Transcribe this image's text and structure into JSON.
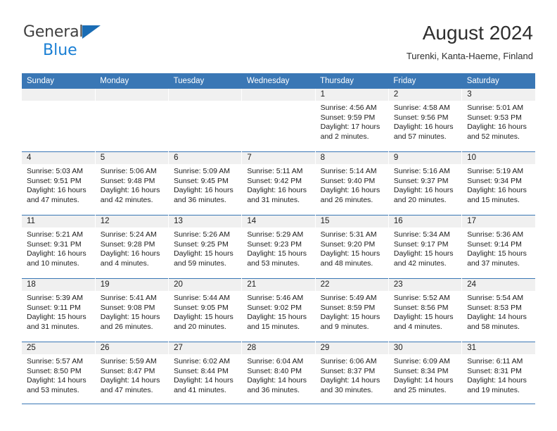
{
  "brand": {
    "name_part1": "General",
    "name_part2": "Blue",
    "accent_color": "#1a7fd4",
    "triangle_color": "#1a6cb4"
  },
  "header": {
    "title": "August 2024",
    "location": "Turenki, Kanta-Haeme, Finland"
  },
  "theme": {
    "header_band": "#3a77b5",
    "daynum_band": "#f0f0f0",
    "text": "#1c1c1c"
  },
  "weekday_headers": [
    "Sunday",
    "Monday",
    "Tuesday",
    "Wednesday",
    "Thursday",
    "Friday",
    "Saturday"
  ],
  "weeks": [
    [
      {
        "day": "",
        "sunrise": "",
        "sunset": "",
        "daylight1": "",
        "daylight2": ""
      },
      {
        "day": "",
        "sunrise": "",
        "sunset": "",
        "daylight1": "",
        "daylight2": ""
      },
      {
        "day": "",
        "sunrise": "",
        "sunset": "",
        "daylight1": "",
        "daylight2": ""
      },
      {
        "day": "",
        "sunrise": "",
        "sunset": "",
        "daylight1": "",
        "daylight2": ""
      },
      {
        "day": "1",
        "sunrise": "Sunrise: 4:56 AM",
        "sunset": "Sunset: 9:59 PM",
        "daylight1": "Daylight: 17 hours",
        "daylight2": "and 2 minutes."
      },
      {
        "day": "2",
        "sunrise": "Sunrise: 4:58 AM",
        "sunset": "Sunset: 9:56 PM",
        "daylight1": "Daylight: 16 hours",
        "daylight2": "and 57 minutes."
      },
      {
        "day": "3",
        "sunrise": "Sunrise: 5:01 AM",
        "sunset": "Sunset: 9:53 PM",
        "daylight1": "Daylight: 16 hours",
        "daylight2": "and 52 minutes."
      }
    ],
    [
      {
        "day": "4",
        "sunrise": "Sunrise: 5:03 AM",
        "sunset": "Sunset: 9:51 PM",
        "daylight1": "Daylight: 16 hours",
        "daylight2": "and 47 minutes."
      },
      {
        "day": "5",
        "sunrise": "Sunrise: 5:06 AM",
        "sunset": "Sunset: 9:48 PM",
        "daylight1": "Daylight: 16 hours",
        "daylight2": "and 42 minutes."
      },
      {
        "day": "6",
        "sunrise": "Sunrise: 5:09 AM",
        "sunset": "Sunset: 9:45 PM",
        "daylight1": "Daylight: 16 hours",
        "daylight2": "and 36 minutes."
      },
      {
        "day": "7",
        "sunrise": "Sunrise: 5:11 AM",
        "sunset": "Sunset: 9:42 PM",
        "daylight1": "Daylight: 16 hours",
        "daylight2": "and 31 minutes."
      },
      {
        "day": "8",
        "sunrise": "Sunrise: 5:14 AM",
        "sunset": "Sunset: 9:40 PM",
        "daylight1": "Daylight: 16 hours",
        "daylight2": "and 26 minutes."
      },
      {
        "day": "9",
        "sunrise": "Sunrise: 5:16 AM",
        "sunset": "Sunset: 9:37 PM",
        "daylight1": "Daylight: 16 hours",
        "daylight2": "and 20 minutes."
      },
      {
        "day": "10",
        "sunrise": "Sunrise: 5:19 AM",
        "sunset": "Sunset: 9:34 PM",
        "daylight1": "Daylight: 16 hours",
        "daylight2": "and 15 minutes."
      }
    ],
    [
      {
        "day": "11",
        "sunrise": "Sunrise: 5:21 AM",
        "sunset": "Sunset: 9:31 PM",
        "daylight1": "Daylight: 16 hours",
        "daylight2": "and 10 minutes."
      },
      {
        "day": "12",
        "sunrise": "Sunrise: 5:24 AM",
        "sunset": "Sunset: 9:28 PM",
        "daylight1": "Daylight: 16 hours",
        "daylight2": "and 4 minutes."
      },
      {
        "day": "13",
        "sunrise": "Sunrise: 5:26 AM",
        "sunset": "Sunset: 9:25 PM",
        "daylight1": "Daylight: 15 hours",
        "daylight2": "and 59 minutes."
      },
      {
        "day": "14",
        "sunrise": "Sunrise: 5:29 AM",
        "sunset": "Sunset: 9:23 PM",
        "daylight1": "Daylight: 15 hours",
        "daylight2": "and 53 minutes."
      },
      {
        "day": "15",
        "sunrise": "Sunrise: 5:31 AM",
        "sunset": "Sunset: 9:20 PM",
        "daylight1": "Daylight: 15 hours",
        "daylight2": "and 48 minutes."
      },
      {
        "day": "16",
        "sunrise": "Sunrise: 5:34 AM",
        "sunset": "Sunset: 9:17 PM",
        "daylight1": "Daylight: 15 hours",
        "daylight2": "and 42 minutes."
      },
      {
        "day": "17",
        "sunrise": "Sunrise: 5:36 AM",
        "sunset": "Sunset: 9:14 PM",
        "daylight1": "Daylight: 15 hours",
        "daylight2": "and 37 minutes."
      }
    ],
    [
      {
        "day": "18",
        "sunrise": "Sunrise: 5:39 AM",
        "sunset": "Sunset: 9:11 PM",
        "daylight1": "Daylight: 15 hours",
        "daylight2": "and 31 minutes."
      },
      {
        "day": "19",
        "sunrise": "Sunrise: 5:41 AM",
        "sunset": "Sunset: 9:08 PM",
        "daylight1": "Daylight: 15 hours",
        "daylight2": "and 26 minutes."
      },
      {
        "day": "20",
        "sunrise": "Sunrise: 5:44 AM",
        "sunset": "Sunset: 9:05 PM",
        "daylight1": "Daylight: 15 hours",
        "daylight2": "and 20 minutes."
      },
      {
        "day": "21",
        "sunrise": "Sunrise: 5:46 AM",
        "sunset": "Sunset: 9:02 PM",
        "daylight1": "Daylight: 15 hours",
        "daylight2": "and 15 minutes."
      },
      {
        "day": "22",
        "sunrise": "Sunrise: 5:49 AM",
        "sunset": "Sunset: 8:59 PM",
        "daylight1": "Daylight: 15 hours",
        "daylight2": "and 9 minutes."
      },
      {
        "day": "23",
        "sunrise": "Sunrise: 5:52 AM",
        "sunset": "Sunset: 8:56 PM",
        "daylight1": "Daylight: 15 hours",
        "daylight2": "and 4 minutes."
      },
      {
        "day": "24",
        "sunrise": "Sunrise: 5:54 AM",
        "sunset": "Sunset: 8:53 PM",
        "daylight1": "Daylight: 14 hours",
        "daylight2": "and 58 minutes."
      }
    ],
    [
      {
        "day": "25",
        "sunrise": "Sunrise: 5:57 AM",
        "sunset": "Sunset: 8:50 PM",
        "daylight1": "Daylight: 14 hours",
        "daylight2": "and 53 minutes."
      },
      {
        "day": "26",
        "sunrise": "Sunrise: 5:59 AM",
        "sunset": "Sunset: 8:47 PM",
        "daylight1": "Daylight: 14 hours",
        "daylight2": "and 47 minutes."
      },
      {
        "day": "27",
        "sunrise": "Sunrise: 6:02 AM",
        "sunset": "Sunset: 8:44 PM",
        "daylight1": "Daylight: 14 hours",
        "daylight2": "and 41 minutes."
      },
      {
        "day": "28",
        "sunrise": "Sunrise: 6:04 AM",
        "sunset": "Sunset: 8:40 PM",
        "daylight1": "Daylight: 14 hours",
        "daylight2": "and 36 minutes."
      },
      {
        "day": "29",
        "sunrise": "Sunrise: 6:06 AM",
        "sunset": "Sunset: 8:37 PM",
        "daylight1": "Daylight: 14 hours",
        "daylight2": "and 30 minutes."
      },
      {
        "day": "30",
        "sunrise": "Sunrise: 6:09 AM",
        "sunset": "Sunset: 8:34 PM",
        "daylight1": "Daylight: 14 hours",
        "daylight2": "and 25 minutes."
      },
      {
        "day": "31",
        "sunrise": "Sunrise: 6:11 AM",
        "sunset": "Sunset: 8:31 PM",
        "daylight1": "Daylight: 14 hours",
        "daylight2": "and 19 minutes."
      }
    ]
  ]
}
